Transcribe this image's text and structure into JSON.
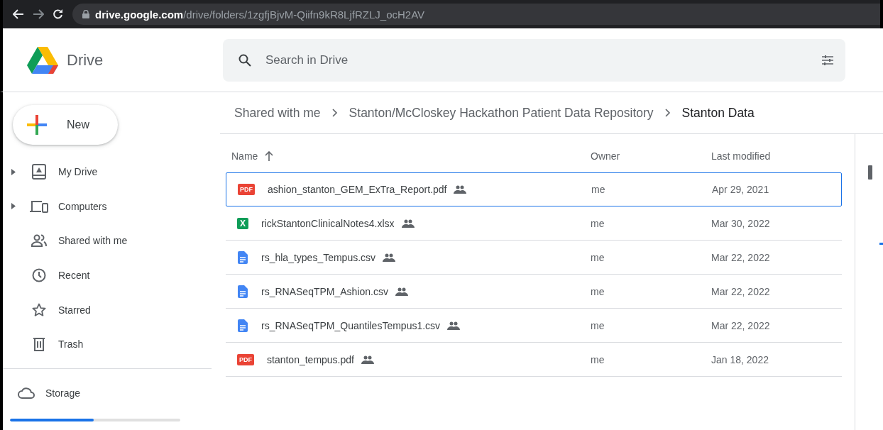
{
  "browser": {
    "url_host": "drive.google.com",
    "url_path": "/drive/folders/1zgfjBjvM-Qiifn9kR8LjfRZLJ_ocH2AV"
  },
  "header": {
    "app_name": "Drive",
    "search": {
      "placeholder": "Search in Drive"
    }
  },
  "sidebar": {
    "new_button": "New",
    "items": [
      {
        "label": "My Drive",
        "kind": "mydrive",
        "expandable": true
      },
      {
        "label": "Computers",
        "kind": "computers",
        "expandable": true
      },
      {
        "label": "Shared with me",
        "kind": "shared",
        "expandable": false
      },
      {
        "label": "Recent",
        "kind": "recent",
        "expandable": false
      },
      {
        "label": "Starred",
        "kind": "starred",
        "expandable": false
      },
      {
        "label": "Trash",
        "kind": "trash",
        "expandable": false
      }
    ],
    "storage": {
      "label": "Storage",
      "level": 0.49
    }
  },
  "breadcrumb": [
    "Shared with me",
    "Stanton/McCloskey Hackathon Patient Data Repository",
    "Stanton Data"
  ],
  "table": {
    "columns": [
      "Name",
      "Owner",
      "Last modified"
    ],
    "rows": [
      {
        "kind": "pdf",
        "badge": "PDF",
        "name": "ashion_stanton_GEM_ExTra_Report.pdf",
        "owner": "me",
        "modified": "Apr 29, 2021",
        "selected": true
      },
      {
        "kind": "xlsx",
        "badge": "X",
        "name": "rickStantonClinicalNotes4.xlsx",
        "owner": "me",
        "modified": "Mar 30, 2022",
        "selected": false
      },
      {
        "kind": "csv",
        "name": "rs_hla_types_Tempus.csv",
        "owner": "me",
        "modified": "Mar 22, 2022",
        "selected": false
      },
      {
        "kind": "csv",
        "name": "rs_RNASeqTPM_Ashion.csv",
        "owner": "me",
        "modified": "Mar 22, 2022",
        "selected": false
      },
      {
        "kind": "csv",
        "name": "rs_RNASeqTPM_QuantilesTempus1.csv",
        "owner": "me",
        "modified": "Mar 22, 2022",
        "selected": false
      },
      {
        "kind": "pdf",
        "badge": "PDF",
        "name": "stanton_tempus.pdf",
        "owner": "me",
        "modified": "Jan 18, 2022",
        "selected": false
      }
    ]
  }
}
